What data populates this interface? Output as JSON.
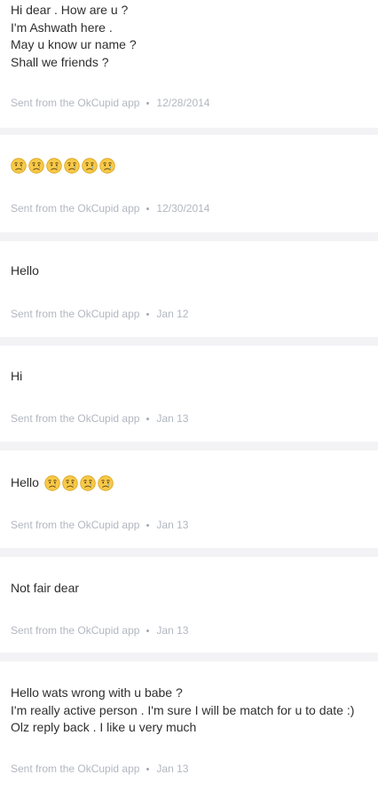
{
  "app": "OkCupid",
  "messages": [
    {
      "lines": [
        {
          "text": "Hi dear . How are u ?"
        },
        {
          "text": "I'm Ashwath here ."
        },
        {
          "text": "May u know ur name ?"
        },
        {
          "text": "Shall we friends ?"
        }
      ],
      "source": "Sent from the OkCupid app",
      "date": "12/28/2014"
    },
    {
      "lines": [
        {
          "text": "",
          "emoji": [
            "crying-face",
            "crying-face",
            "crying-face",
            "crying-face",
            "crying-face",
            "crying-face"
          ]
        }
      ],
      "source": "Sent from the OkCupid app",
      "date": "12/30/2014"
    },
    {
      "lines": [
        {
          "text": "Hello"
        }
      ],
      "source": "Sent from the OkCupid app",
      "date": "Jan 12"
    },
    {
      "lines": [
        {
          "text": "Hi"
        }
      ],
      "source": "Sent from the OkCupid app",
      "date": "Jan 13"
    },
    {
      "lines": [
        {
          "text": "Hello",
          "emoji": [
            "crying-face",
            "crying-face",
            "crying-face",
            "crying-face"
          ]
        }
      ],
      "source": "Sent from the OkCupid app",
      "date": "Jan 13"
    },
    {
      "lines": [
        {
          "text": "Not fair dear"
        }
      ],
      "source": "Sent from the OkCupid app",
      "date": "Jan 13"
    },
    {
      "lines": [
        {
          "text": "Hello wats wrong with u babe ?"
        },
        {
          "text": "I'm really active person . I'm sure I will be match for u to date :)"
        },
        {
          "text": "Olz reply back . I like u very much"
        }
      ],
      "source": "Sent from the OkCupid app",
      "date": "Jan 13"
    }
  ]
}
